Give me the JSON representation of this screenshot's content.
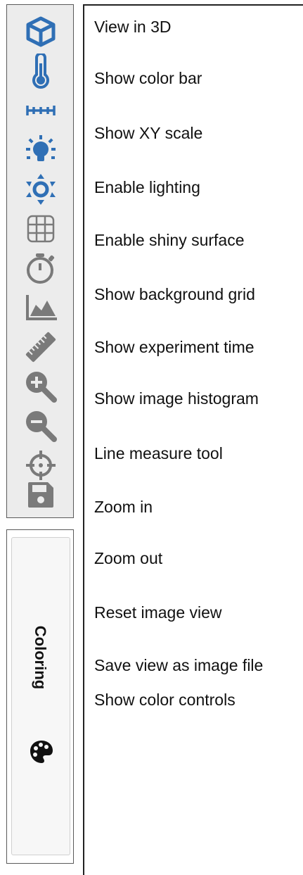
{
  "toolbar": {
    "items": [
      {
        "icon": "cube-icon",
        "label": "View in 3D",
        "active": true
      },
      {
        "icon": "thermometer-icon",
        "label": "Show color bar",
        "active": true
      },
      {
        "icon": "xy-scale-icon",
        "label": "Show XY scale",
        "active": true
      },
      {
        "icon": "lightbulb-icon",
        "label": "Enable lighting",
        "active": true
      },
      {
        "icon": "shiny-surface-icon",
        "label": "Enable shiny surface",
        "active": true
      },
      {
        "icon": "grid-icon",
        "label": "Show background grid",
        "active": false
      },
      {
        "icon": "stopwatch-icon",
        "label": "Show experiment time",
        "active": false
      },
      {
        "icon": "histogram-icon",
        "label": "Show image histogram",
        "active": false
      },
      {
        "icon": "ruler-icon",
        "label": "Line measure tool",
        "active": false
      },
      {
        "icon": "zoom-in-icon",
        "label": "Zoom in",
        "active": false
      },
      {
        "icon": "zoom-out-icon",
        "label": "Zoom out",
        "active": false
      },
      {
        "icon": "crosshair-icon",
        "label": "Reset image view",
        "active": false
      },
      {
        "icon": "save-icon",
        "label": "Save view as image file",
        "active": false
      }
    ]
  },
  "coloring": {
    "tab_label": "Coloring",
    "icon": "palette-icon",
    "description": "Show color controls"
  },
  "colors": {
    "active": "#2f6fb5",
    "inactive": "#7a7a7a"
  }
}
